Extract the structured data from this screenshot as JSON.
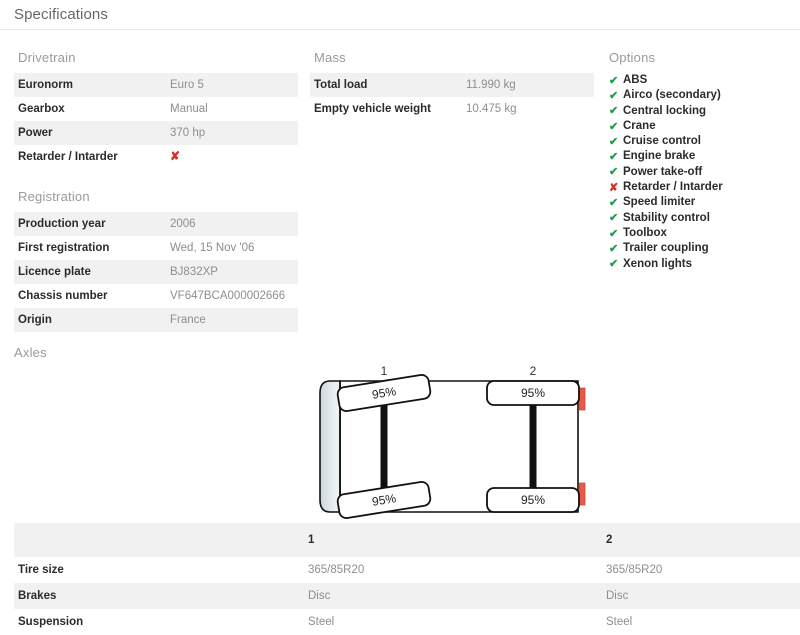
{
  "header": {
    "title": "Specifications"
  },
  "sections": {
    "drivetrain": {
      "heading": "Drivetrain",
      "rows": [
        {
          "key": "Euronorm",
          "value": "Euro 5",
          "type": "text"
        },
        {
          "key": "Gearbox",
          "value": "Manual",
          "type": "text"
        },
        {
          "key": "Power",
          "value": "370 hp",
          "type": "text"
        },
        {
          "key": "Retarder / Intarder",
          "value": "✘",
          "type": "xmark"
        }
      ]
    },
    "registration": {
      "heading": "Registration",
      "rows": [
        {
          "key": "Production year",
          "value": "2006",
          "type": "text"
        },
        {
          "key": "First registration",
          "value": "Wed, 15 Nov '06",
          "type": "text"
        },
        {
          "key": "Licence plate",
          "value": "BJ832XP",
          "type": "text"
        },
        {
          "key": "Chassis number",
          "value": "VF647BCA000002666",
          "type": "text"
        },
        {
          "key": "Origin",
          "value": "France",
          "type": "text"
        }
      ]
    },
    "mass": {
      "heading": "Mass",
      "rows": [
        {
          "key": "Total load",
          "value": "11.990 kg",
          "type": "text"
        },
        {
          "key": "Empty vehicle weight",
          "value": "10.475 kg",
          "type": "text"
        }
      ]
    },
    "options": {
      "heading": "Options",
      "items": [
        {
          "label": "ABS",
          "present": true
        },
        {
          "label": "Airco (secondary)",
          "present": true
        },
        {
          "label": "Central locking",
          "present": true
        },
        {
          "label": "Crane",
          "present": true
        },
        {
          "label": "Cruise control",
          "present": true
        },
        {
          "label": "Engine brake",
          "present": true
        },
        {
          "label": "Power take-off",
          "present": true
        },
        {
          "label": "Retarder / Intarder",
          "present": false
        },
        {
          "label": "Speed limiter",
          "present": true
        },
        {
          "label": "Stability control",
          "present": true
        },
        {
          "label": "Toolbox",
          "present": true
        },
        {
          "label": "Trailer coupling",
          "present": true
        },
        {
          "label": "Xenon lights",
          "present": true
        }
      ],
      "check_glyph": "✔",
      "cross_glyph": "✘"
    },
    "axles": {
      "heading": "Axles",
      "diagram": {
        "axle_labels": [
          "1",
          "2"
        ],
        "tyre_wear": [
          {
            "axle": "1",
            "left": "95%",
            "right": "95%"
          },
          {
            "axle": "2",
            "left": "95%",
            "right": "95%"
          }
        ]
      },
      "table": {
        "columns": [
          "",
          "1",
          "2"
        ],
        "rows": [
          {
            "key": "Tire size",
            "values": [
              "365/85R20",
              "365/85R20"
            ]
          },
          {
            "key": "Brakes",
            "values": [
              "Disc",
              "Disc"
            ]
          },
          {
            "key": "Suspension",
            "values": [
              "Steel",
              "Steel"
            ]
          }
        ]
      }
    }
  },
  "colors": {
    "row_stripe": "#f1f1f1",
    "option_yes": "#1e9e4a",
    "option_no": "#d93025",
    "heading": "#9a9a9a",
    "value_text": "#8e8e8e",
    "key_text": "#2b2b2b",
    "rear_light": "#e8594a",
    "cab_fill": "#dde5e8"
  }
}
